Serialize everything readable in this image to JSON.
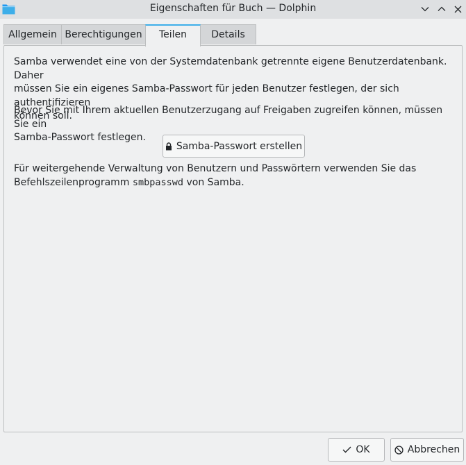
{
  "window": {
    "title": "Eigenschaften für Buch — Dolphin",
    "app_icon": "folder-icon",
    "controls": [
      "minimize-icon",
      "maximize-icon",
      "close-icon"
    ]
  },
  "tabs": [
    {
      "label": "Allgemein",
      "active": false
    },
    {
      "label": "Berechtigungen",
      "active": false
    },
    {
      "label": "Teilen",
      "active": true
    },
    {
      "label": "Details",
      "active": false
    }
  ],
  "sharing": {
    "para1_line1": "Samba verwendet eine von der Systemdatenbank getrennte eigene Benutzerdatenbank. Daher",
    "para1_line2": "müssen Sie ein eigenes Samba-Passwort für jeden Benutzer festlegen, der sich authentifizieren",
    "para1_line3": "können soll.",
    "para2_line1": "Bevor Sie mit Ihrem aktuellen Benutzerzugang auf Freigaben zugreifen können, müssen Sie ein",
    "para2_line2": "Samba-Passwort festlegen.",
    "create_password_button": "Samba-Passwort erstellen",
    "create_password_icon": "lock-icon",
    "para3_line1": "Für weitergehende Verwaltung von Benutzern und Passwörtern verwenden Sie das",
    "para3_line2_pre": "Befehlszeilenprogramm ",
    "para3_command": "smbpasswd",
    "para3_line2_post": " von Samba."
  },
  "buttons": {
    "ok_label": "OK",
    "ok_icon": "checkmark-icon",
    "cancel_label": "Abbrechen",
    "cancel_icon": "cancel-icon"
  },
  "colors": {
    "accent": "#3daee9",
    "window_bg": "#eff0f1",
    "titlebar_bg": "#dee0e2"
  }
}
